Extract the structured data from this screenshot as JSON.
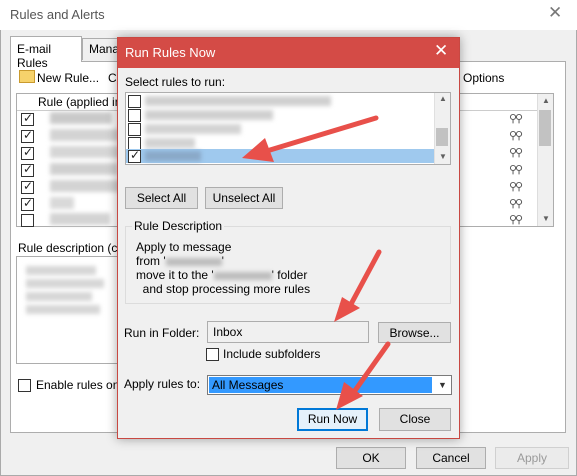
{
  "background_window": {
    "title": "Rules and Alerts",
    "close_glyph": "✕",
    "tabs": [
      "E-mail Rules",
      "Mana"
    ],
    "toolbar": {
      "new_rule": "New Rule...",
      "c_fragment": "C",
      "options": "Options"
    },
    "list_header": "Rule (applied in",
    "rule_description_label": "Rule description (cli",
    "enable_rules_label": "Enable rules on",
    "buttons": {
      "ok": "OK",
      "cancel": "Cancel",
      "apply": "Apply"
    }
  },
  "dialog": {
    "title": "Run Rules Now",
    "close_glyph": "✕",
    "select_label": "Select rules to run:",
    "rules": [
      {
        "checked": false,
        "selected": false
      },
      {
        "checked": false,
        "selected": false
      },
      {
        "checked": false,
        "selected": false
      },
      {
        "checked": false,
        "selected": false
      },
      {
        "checked": true,
        "selected": true
      }
    ],
    "select_all": "Select All",
    "unselect_all": "Unselect All",
    "rule_description_group": "Rule Description",
    "description_lines": [
      "Apply to message",
      "from '",
      "move it to the '",
      "  and stop processing more rules"
    ],
    "description_suffix_folder": "' folder",
    "run_in_folder_label": "Run in Folder:",
    "folder_value": "Inbox",
    "browse": "Browse...",
    "include_subfolders": "Include subfolders",
    "apply_rules_to_label": "Apply rules to:",
    "apply_rules_to_value": "All Messages",
    "run_now": "Run Now",
    "close": "Close"
  },
  "colors": {
    "dialog_titlebar": "#d44b46",
    "selection": "#9fc9ee",
    "dropdown_selection": "#3399ff",
    "annotation_arrows": "#e8504a"
  },
  "icons": {
    "new_rule": "new-rule-icon",
    "scroll_up": "scroll-up-arrow-icon",
    "scroll_down": "scroll-down-arrow-icon",
    "dropdown": "chevron-down-icon"
  }
}
